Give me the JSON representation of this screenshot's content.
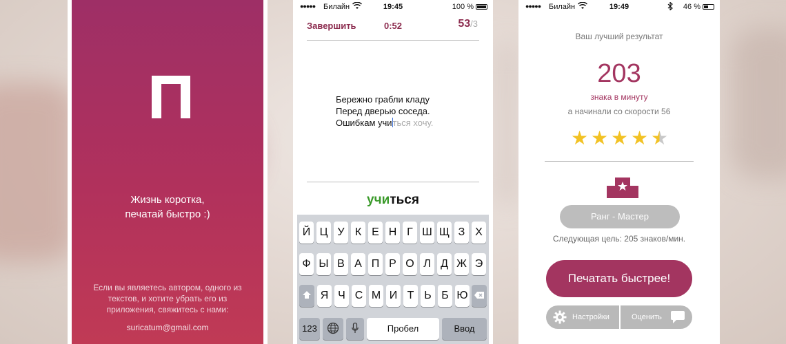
{
  "screen1": {
    "logo_text": "п",
    "slogan_line1": "Жизнь коротка,",
    "slogan_line2": "печатай быстро :)",
    "author_note": "Если вы являетесь автором, одного из текстов, и хотите убрать его из приложения, свяжитесь с нами:",
    "email": "suricatum@gmail.com",
    "gradient_top": "#9e2f66",
    "gradient_bottom": "#c03a55"
  },
  "screen2": {
    "status": {
      "carrier": "Билайн",
      "time": "19:45",
      "battery": "100 %",
      "signal_icon": "signal-dots-icon",
      "wifi_icon": "wifi-icon",
      "battery_icon": "battery-icon",
      "battery_level": 1.0
    },
    "finish_label": "Завершить",
    "timer": "0:52",
    "score": "53",
    "score_total": "/3",
    "poem": {
      "line1": "Бережно грабли кладу",
      "line2": "Перед дверью соседа.",
      "line3_typed": "Ошибкам учи",
      "line3_pending": "ться хочу."
    },
    "current_word": {
      "typed": "учи",
      "rest": "ться"
    },
    "keyboard": {
      "row1": [
        "Й",
        "Ц",
        "У",
        "К",
        "Е",
        "Н",
        "Г",
        "Ш",
        "Щ",
        "З",
        "Х"
      ],
      "row2": [
        "Ф",
        "Ы",
        "В",
        "А",
        "П",
        "Р",
        "О",
        "Л",
        "Д",
        "Ж",
        "Э"
      ],
      "row3": [
        "Я",
        "Ч",
        "С",
        "М",
        "И",
        "Т",
        "Ь",
        "Б",
        "Ю"
      ],
      "shift_icon": "shift-arrow-icon",
      "backspace_icon": "backspace-icon",
      "numbers_label": "123",
      "globe_icon": "globe-icon",
      "mic_icon": "microphone-icon",
      "space_label": "Пробел",
      "return_label": "Ввод"
    }
  },
  "screen3": {
    "status": {
      "carrier": "Билайн",
      "time": "19:49",
      "battery": "46 %",
      "bluetooth_icon": "bluetooth-icon",
      "battery_level": 0.46
    },
    "title": "Ваш лучший результат",
    "best_score": "203",
    "cpm_label": "знака в минуту",
    "start_speed": "а начинали со скорости 56",
    "rating": 4.5,
    "rank_icon": "podium-star-icon",
    "rank_label": "Ранг - Мастер",
    "next_goal": "Следующая цель: 205 знаков/мин.",
    "faster_button": "Печатать быстрее!",
    "settings_label": "Настройки",
    "settings_icon": "gear-icon",
    "rate_label": "Оценить",
    "rate_icon": "speech-bubble-icon",
    "accent_color": "#a33560"
  }
}
